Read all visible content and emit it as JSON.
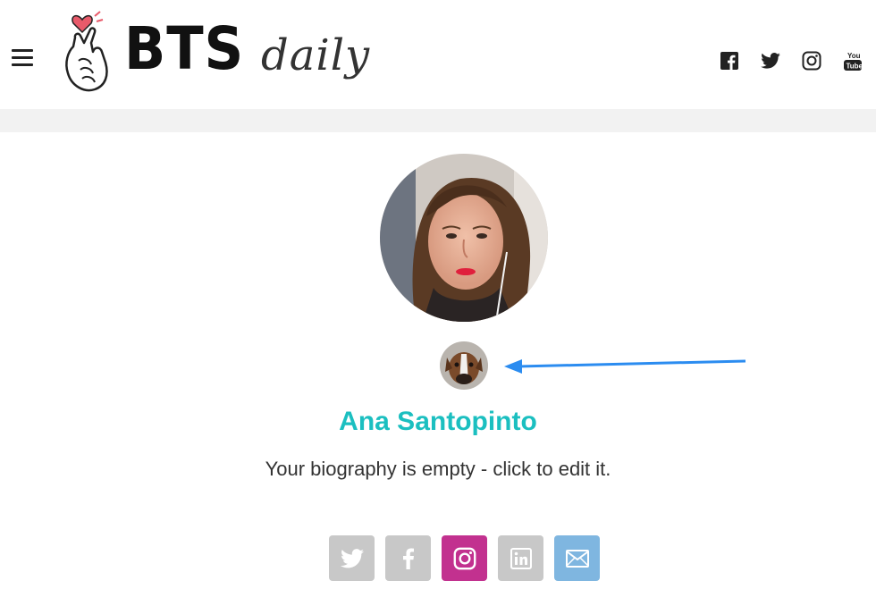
{
  "header": {
    "logo": {
      "brand": "BTS",
      "tagline": "daily"
    },
    "social_icons": [
      "facebook-icon",
      "twitter-icon",
      "instagram-icon",
      "youtube-icon"
    ]
  },
  "profile": {
    "name": "Ana Santopinto",
    "bio": "Your biography is empty - click to edit it."
  },
  "share_buttons": [
    {
      "name": "twitter",
      "color": "#c8c8c8"
    },
    {
      "name": "facebook",
      "color": "#c8c8c8"
    },
    {
      "name": "instagram",
      "color": "#c2318f"
    },
    {
      "name": "linkedin",
      "color": "#c8c8c8"
    },
    {
      "name": "email",
      "color": "#7fb6e0"
    }
  ],
  "colors": {
    "name_accent": "#1bbfc0",
    "annotation_arrow": "#2b8cf0",
    "header_band": "#f2f2f2"
  }
}
